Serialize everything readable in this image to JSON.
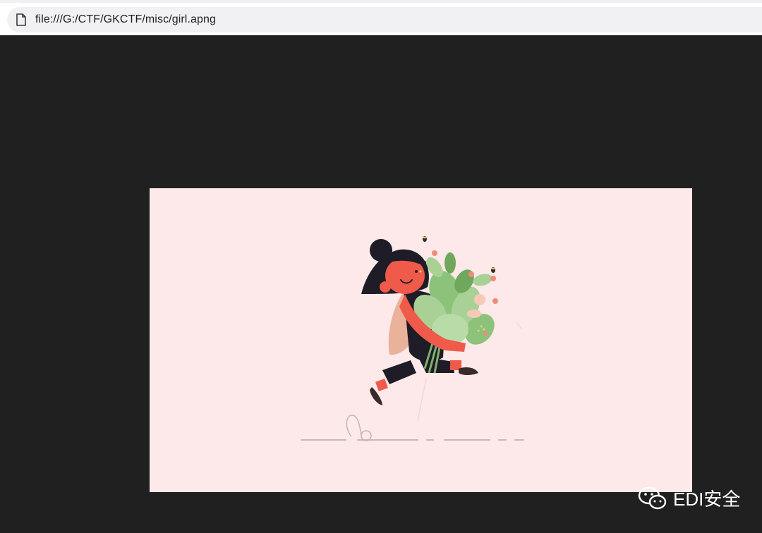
{
  "browser": {
    "address_bar": {
      "url": "file:///G:/CTF/GKCTF/misc/girl.apng",
      "icon": "file-icon"
    }
  },
  "content": {
    "image": {
      "subject": "illustration",
      "background_color": "#fde9e9"
    }
  },
  "watermark": {
    "text": "EDI安全",
    "icon": "wechat-icon"
  },
  "colors": {
    "page_background": "#202020",
    "image_background": "#fde9e9",
    "skin": "#f05a4a",
    "hair": "#1e1c26",
    "leaf": "#8cc27a"
  }
}
